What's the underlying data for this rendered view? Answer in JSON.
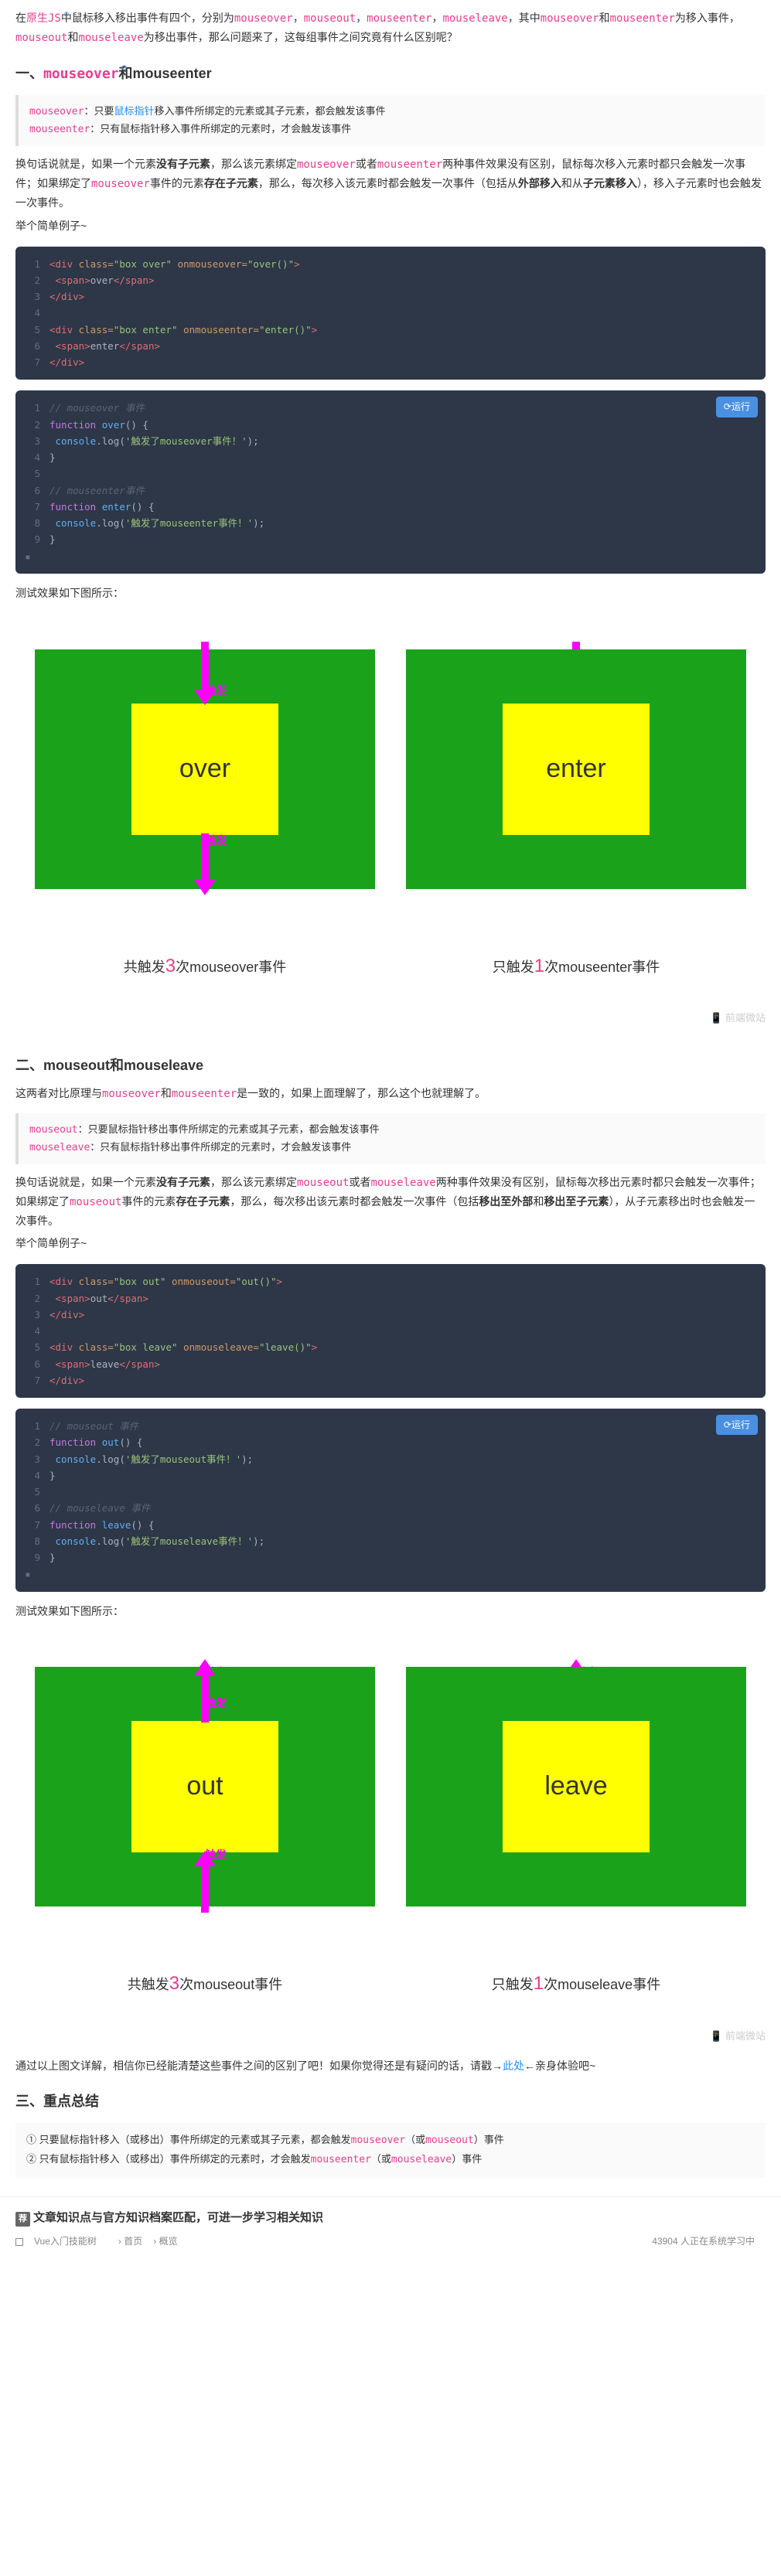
{
  "intro": {
    "p1a": "在",
    "p1b": "原生JS",
    "p1c": "中鼠标移入移出事件有四个，分别为",
    "kw1": "mouseover",
    "kw2": "mouseout",
    "kw3": "mouseenter",
    "kw4": "mouseleave",
    "p1d": "，其中",
    "p1e": "和",
    "p1f": "为移入事件，",
    "p1g": "和",
    "p1h": "为移出事件，那么问题来了，这每组事件之间究竟有什么区别呢？"
  },
  "h1a": "一、",
  "h1b": "mouseover",
  "h1c": "和mouseenter",
  "q1a": "mouseover",
  "q1b": "：只要",
  "q1c": "鼠标指针",
  "q1d": "移入事件所绑定的元素或其子元素，都会触发该事件",
  "q1e": "mouseenter",
  "q1f": "：只有鼠标指针移入事件所绑定的元素时，才会触发该事件",
  "p2a": "换句话说就是，如果一个元素",
  "p2b": "没有子元素",
  "p2c": "，那么该元素绑定",
  "p2d": "或者",
  "p2e": "两种事件效果没有区别，鼠标每次移入元素时都只会触发一次事件；如果绑定了",
  "p2f": "事件的元素",
  "p2g": "存在子元素",
  "p2h": "，那么，每次移入该元素时都会触发一次事件（包括从",
  "p2i": "外部移入",
  "p2j": "和从",
  "p2k": "子元素移入",
  "p2l": "），移入子元素时也会触发一次事件。",
  "ex_label": "举个简单例子~",
  "code1": {
    "l1a": "<div",
    "l1b": " class=",
    "l1c": "\"box over\"",
    "l1d": " onmouseover=",
    "l1e": "\"over()\"",
    "l1f": ">",
    "l2a": "<span>",
    "l2b": "over",
    "l2c": "</span>",
    "l3": "</div>",
    "l5a": "<div",
    "l5b": " class=",
    "l5c": "\"box enter\"",
    "l5d": " onmouseenter=",
    "l5e": "\"enter()\"",
    "l5f": ">",
    "l6a": "<span>",
    "l6b": "enter",
    "l6c": "</span>",
    "l7": "</div>"
  },
  "run_label": "运行",
  "code2": {
    "c1": "// mouseover 事件",
    "l2a": "function",
    "l2b": " over",
    "l2c": "() {",
    "l3a": "console",
    "l3b": ".log(",
    "l3c": "'触发了mouseover事件！'",
    "l3d": ");",
    "l4": "}",
    "c2": "// mouseenter事件",
    "l7a": "function",
    "l7b": " enter",
    "l7c": "() {",
    "l8a": "console",
    "l8b": ".log(",
    "l8c": "'触发了mouseenter事件！'",
    "l8d": ");",
    "l9": "}"
  },
  "test_label": "测试效果如下图所示：",
  "trigger": "触发",
  "demo1": {
    "left": "over",
    "right": "enter"
  },
  "result1a": "共触发",
  "result1b": "3",
  "result1c": "次mouseover事件",
  "result1d": "只触发",
  "result1e": "1",
  "result1f": "次mouseenter事件",
  "watermark": "前端微站",
  "h2": "二、mouseout和mouseleave",
  "p3a": "这两者对比原理与",
  "p3b": "和",
  "p3c": "是一致的，如果上面理解了，那么这个也就理解了。",
  "q2a": "mouseout",
  "q2b": "：只要鼠标指针移出事件所绑定的元素或其子元素，都会触发该事件",
  "q2c": "mouseleave",
  "q2d": "：只有鼠标指针移出事件所绑定的元素时，才会触发该事件",
  "p4a": "换句话说就是，如果一个元素",
  "p4b": "没有子元素",
  "p4c": "，那么该元素绑定",
  "p4d": "或者",
  "p4e": "两种事件效果没有区别，鼠标每次移出元素时都只会触发一次事件；如果绑定了",
  "p4f": "事件的元素",
  "p4g": "存在子元素",
  "p4h": "，那么，每次移出该元素时都会触发一次事件（包括",
  "p4i": "移出至外部",
  "p4j": "和",
  "p4k": "移出至子元素",
  "p4l": "），从子元素移出时也会触发一次事件。",
  "code3": {
    "l1a": "<div",
    "l1b": " class=",
    "l1c": "\"box out\"",
    "l1d": " onmouseout=",
    "l1e": "\"out()\"",
    "l1f": ">",
    "l2a": "<span>",
    "l2b": "out",
    "l2c": "</span>",
    "l3": "</div>",
    "l5a": "<div",
    "l5b": " class=",
    "l5c": "\"box leave\"",
    "l5d": " onmouseleave=",
    "l5e": "\"leave()\"",
    "l5f": ">",
    "l6a": "<span>",
    "l6b": "leave",
    "l6c": "</span>",
    "l7": "</div>"
  },
  "code4": {
    "c1": "// mouseout 事件",
    "l2a": "function",
    "l2b": " out",
    "l2c": "() {",
    "l3a": "console",
    "l3b": ".log(",
    "l3c": "'触发了mouseout事件！'",
    "l3d": ");",
    "l4": "}",
    "c2": "// mouseleave 事件",
    "l7a": "function",
    "l7b": " leave",
    "l7c": "() {",
    "l8a": "console",
    "l8b": ".log(",
    "l8c": "'触发了mouseleave事件！'",
    "l8d": ");",
    "l9": "}"
  },
  "demo2": {
    "left": "out",
    "right": "leave"
  },
  "result2a": "共触发",
  "result2b": "3",
  "result2c": "次mouseout事件",
  "result2d": "只触发",
  "result2e": "1",
  "result2f": "次mouseleave事件",
  "p5a": "通过以上图文详解，相信你已经能清楚这些事件之间的区别了吧！如果你觉得还是有疑问的话，请戳→",
  "p5b": "此处",
  "p5c": "←亲身体验吧~",
  "h3": "三、重点总结",
  "s1a": "① 只要鼠标指针移入（或移出）事件所绑定的元素或其子元素，都会触发",
  "s1b": "（或",
  "s1c": "）事件",
  "s2a": "② 只有鼠标指针移入（或移出）事件所绑定的元素时，才会触发",
  "s2b": "（或",
  "s2c": "）事件",
  "footer": {
    "tag": "荐",
    "title": "文章知识点与官方知识档案匹配，可进一步学习相关知识",
    "crumbs": "Vue入门技能树",
    "c2": "首页",
    "c3": "概览",
    "count": "43904 人正在系统学习中"
  }
}
